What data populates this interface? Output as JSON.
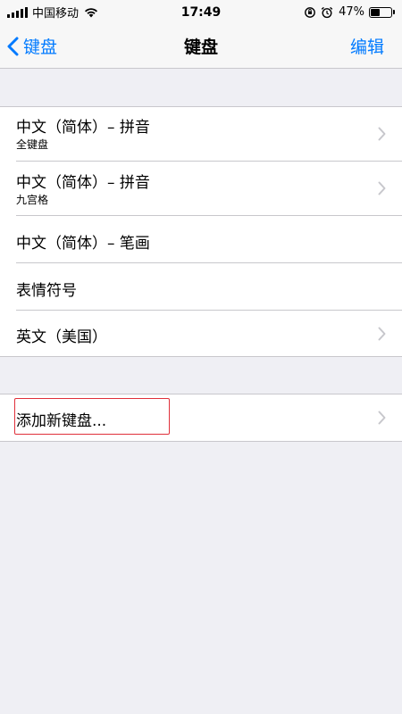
{
  "status_bar": {
    "carrier": "中国移动",
    "time": "17:49",
    "battery": "47%",
    "battery_level": 0.47
  },
  "nav": {
    "back_label": "键盘",
    "title": "键盘",
    "edit_label": "编辑"
  },
  "keyboards": [
    {
      "title": "中文（简体）– 拼音",
      "subtitle": "全键盘"
    },
    {
      "title": "中文（简体）– 拼音",
      "subtitle": "九宫格"
    },
    {
      "title": "中文（简体）– 笔画"
    },
    {
      "title": "表情符号"
    },
    {
      "title": "英文（美国）"
    }
  ],
  "add_keyboard": {
    "label": "添加新键盘..."
  },
  "colors": {
    "accent": "#007aff",
    "highlight": "#e0303a",
    "background": "#efeff4"
  }
}
